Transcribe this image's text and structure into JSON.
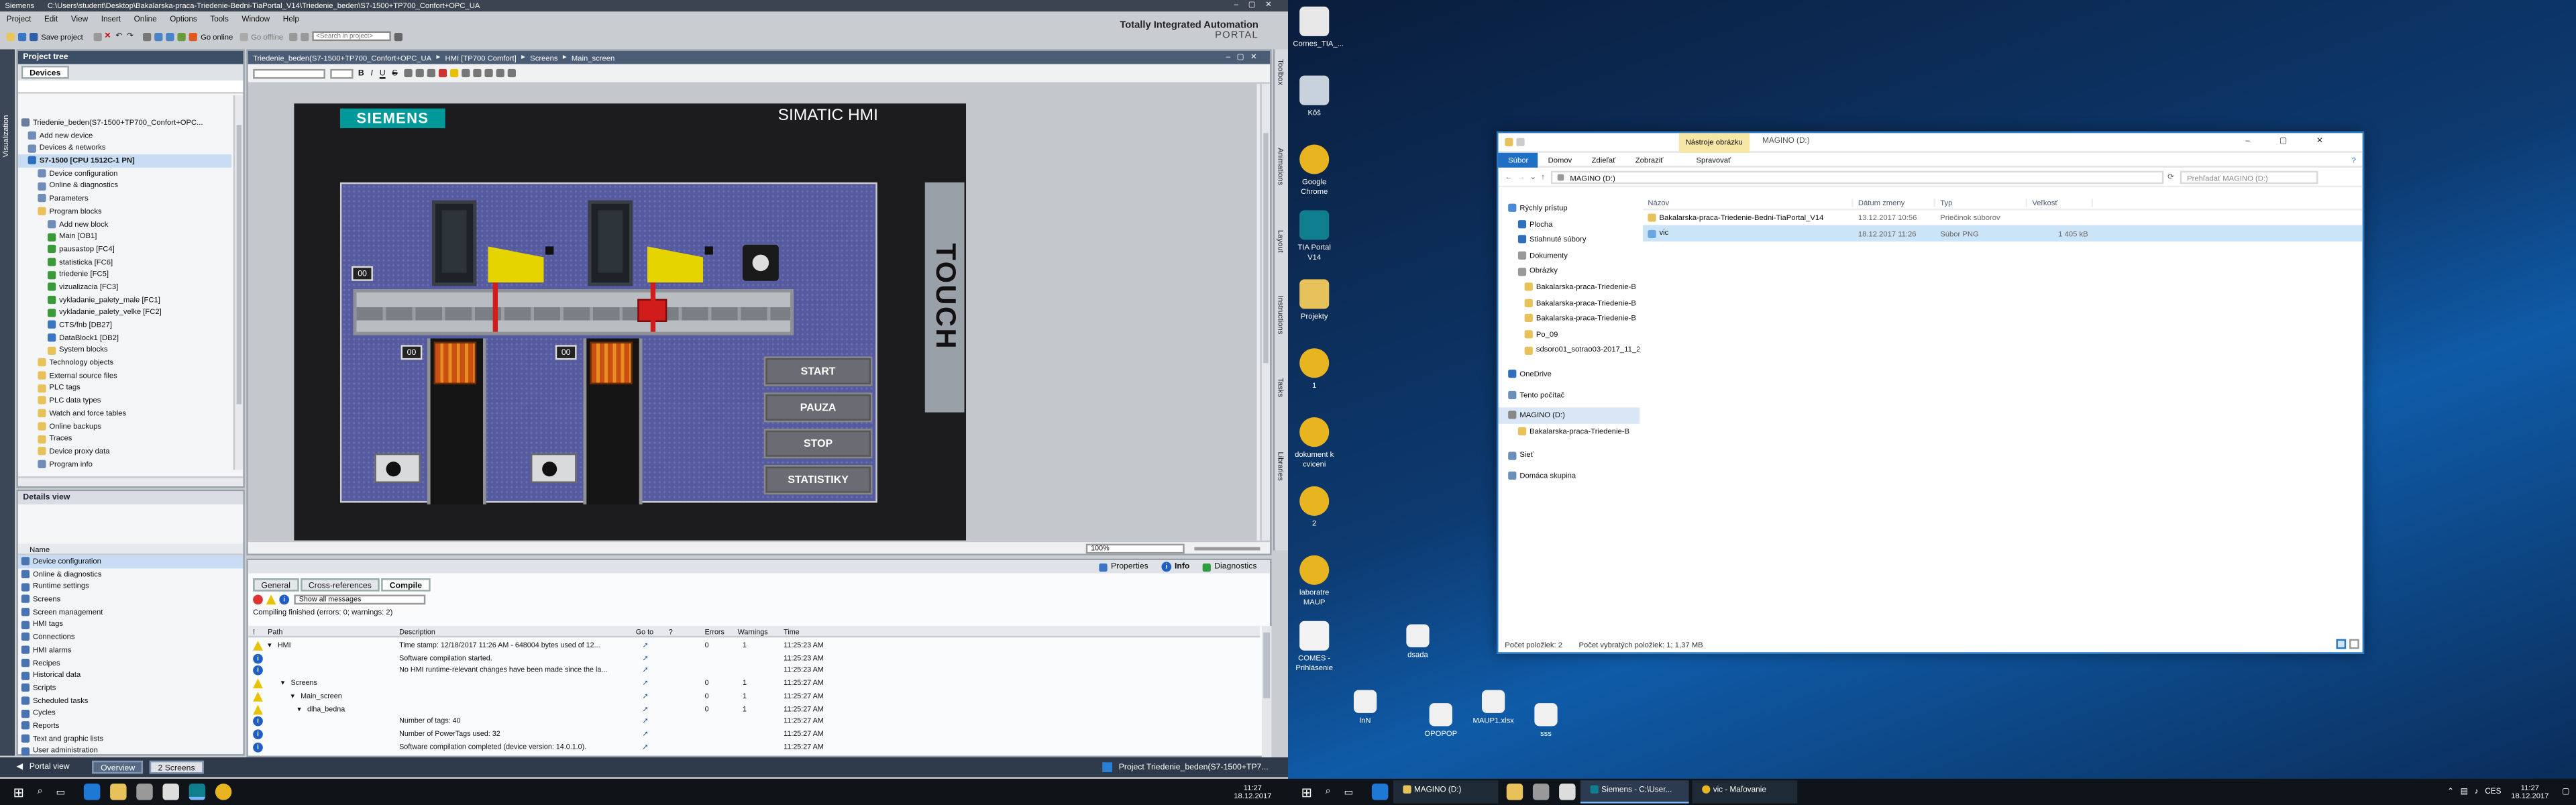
{
  "tia": {
    "title_app": "Siemens",
    "title_path": "C:\\Users\\student\\Desktop\\Bakalarska-praca-Triedenie-Bedni-TiaPortal_V14\\Triedenie_beden\\S7-1500+TP700_Confort+OPC_UA",
    "menu": [
      "Project",
      "Edit",
      "View",
      "Insert",
      "Online",
      "Options",
      "Tools",
      "Window",
      "Help"
    ],
    "toolbar": {
      "save": "Save project",
      "go_online": "Go online",
      "go_offline": "Go offline",
      "search_placeholder": "<Search in project>"
    },
    "brand_line1": "Totally Integrated Automation",
    "brand_line2": "PORTAL",
    "project_tree": {
      "header": "Project tree",
      "tab": "Devices",
      "side_label": "Visualization",
      "items": [
        "Triedenie_beden(S7-1500+TP700_Confort+OPC...",
        "Add new device",
        "Devices & networks",
        "S7-1500 [CPU 1512C-1 PN]",
        "Device configuration",
        "Online & diagnostics",
        "Parameters",
        "Program blocks",
        "Add new block",
        "Main [OB1]",
        "pausastop [FC4]",
        "statisticka [FC6]",
        "triedenie [FC5]",
        "vizualizacia [FC3]",
        "vykladanie_palety_male [FC1]",
        "vykladanie_palety_velke [FC2]",
        "CTS/fnb [DB27]",
        "DataBlock1 [DB2]",
        "System blocks",
        "Technology objects",
        "External source files",
        "PLC tags",
        "PLC data types",
        "Watch and force tables",
        "Online backups",
        "Traces",
        "Device proxy data",
        "Program info"
      ]
    },
    "details": {
      "header": "Details view",
      "col_name": "Name",
      "items": [
        "Device configuration",
        "Online & diagnostics",
        "Runtime settings",
        "Screens",
        "Screen management",
        "HMI tags",
        "Connections",
        "HMI alarms",
        "Recipes",
        "Historical data",
        "Scripts",
        "Scheduled tasks",
        "Cycles",
        "Reports",
        "Text and graphic lists",
        "User administration"
      ]
    },
    "breadcrumb": [
      "Triedenie_beden(S7-1500+TP700_Confort+OPC_UA",
      "HMI [TP700 Comfort]",
      "Screens",
      "Main_screen"
    ],
    "hmi": {
      "logo": "SIEMENS",
      "title": "SIMATIC HMI",
      "touch": "TOUCH",
      "counters": [
        "00",
        "00",
        "00"
      ],
      "buttons": [
        "START",
        "PAUZA",
        "STOP",
        "STATISTIKY"
      ]
    },
    "zoom": "100%",
    "right_tabs": [
      "Toolbox",
      "Animations",
      "Layout",
      "Instructions",
      "Tasks",
      "Libraries"
    ],
    "inspector_tabs": {
      "properties": "Properties",
      "info": "Info",
      "diagnostics": "Diagnostics"
    },
    "bottom_tabs": [
      "General",
      "Cross-references",
      "Compile"
    ],
    "filter": "Show all messages",
    "compile_status": "Compiling finished (errors: 0; warnings: 2)",
    "columns": [
      "!",
      "Path",
      "Description",
      "Go to",
      "?",
      "Errors",
      "Warnings",
      "Time"
    ],
    "rows": [
      {
        "icon": "warn",
        "path": "HMI",
        "desc": "Time stamp: 12/18/2017 11:26 AM - 648004 bytes used of 12...",
        "errors": "0",
        "warnings": "1",
        "time": "11:25:23 AM"
      },
      {
        "icon": "info",
        "path": "",
        "desc": "Software compilation started.",
        "errors": "",
        "warnings": "",
        "time": "11:25:23 AM"
      },
      {
        "icon": "info",
        "path": "",
        "desc": "No HMI runtime-relevant changes have been made since the la...",
        "errors": "",
        "warnings": "",
        "time": "11:25:23 AM"
      },
      {
        "icon": "warn",
        "path": "Screens",
        "desc": "",
        "errors": "0",
        "warnings": "1",
        "time": "11:25:27 AM"
      },
      {
        "icon": "warn",
        "path": "Main_screen",
        "desc": "",
        "errors": "0",
        "warnings": "1",
        "time": "11:25:27 AM"
      },
      {
        "icon": "warn",
        "path": "dlha_bedna",
        "desc": "",
        "errors": "0",
        "warnings": "1",
        "time": "11:25:27 AM"
      },
      {
        "icon": "info",
        "path": "",
        "desc": "Number of tags: 40",
        "errors": "",
        "warnings": "",
        "time": "11:25:27 AM"
      },
      {
        "icon": "info",
        "path": "",
        "desc": "Number of PowerTags used: 32",
        "errors": "",
        "warnings": "",
        "time": "11:25:27 AM"
      },
      {
        "icon": "info",
        "path": "",
        "desc": "Software compilation completed (device version: 14.0.1.0).",
        "errors": "",
        "warnings": "",
        "time": "11:25:27 AM"
      }
    ],
    "portal_view": "Portal view",
    "overview": "Overview",
    "screens_tab": "2 Screens",
    "status_project": "Project Triedenie_beden(S7-1500+TP7..."
  },
  "taskbar_left": {
    "time": "11:27",
    "date": "18.12.2017"
  },
  "desktop_icons": [
    {
      "label": "Cornes_TIA_..."
    },
    {
      "label": "Kôš"
    },
    {
      "label": "Google Chrome"
    },
    {
      "label": "TIA Portal V14"
    },
    {
      "label": "Projekty"
    },
    {
      "label": "1"
    },
    {
      "label": "dokument k cviceni"
    },
    {
      "label": "2"
    },
    {
      "label": "laboratre MAUP"
    },
    {
      "label": "COMES - Prihlásenie"
    }
  ],
  "desktop_files": [
    {
      "label": "dsada"
    },
    {
      "label": "lnN"
    },
    {
      "label": "OPOPOP"
    },
    {
      "label": "MAUP1.xlsx"
    },
    {
      "label": "sss"
    }
  ],
  "explorer": {
    "title": "MAGINO (D:)",
    "context_tab": "Nástroje obrázku",
    "ribbon": [
      "Súbor",
      "Domov",
      "Zdieľať",
      "Zobraziť",
      "Spravovať"
    ],
    "address": "MAGINO (D:)",
    "search_placeholder": "Prehľadať MAGINO (D:)",
    "nav": [
      "Rýchly prístup",
      "Plocha",
      "Stiahnuté súbory",
      "Dokumenty",
      "Obrázky",
      "Bakalarska-praca-Triedenie-B",
      "Bakalarska-praca-Triedenie-B",
      "Bakalarska-praca-Triedenie-B",
      "Po_09",
      "sdsoro01_sotrao03-2017_11_22",
      "OneDrive",
      "Tento počítač",
      "MAGINO (D:)",
      "Bakalarska-praca-Triedenie-B",
      "Sieť",
      "Domáca skupina"
    ],
    "cols": [
      "Názov",
      "Dátum zmeny",
      "Typ",
      "Veľkosť"
    ],
    "files": [
      {
        "name": "Bakalarska-praca-Triedenie-Bedni-TiaPortal_V14",
        "date": "13.12.2017 10:56",
        "type": "Priečinok súborov",
        "size": ""
      },
      {
        "name": "vic",
        "date": "18.12.2017 11:26",
        "type": "Súbor PNG",
        "size": "1 405 kB"
      }
    ],
    "status": [
      "Počet položiek: 2",
      "Počet vybratých položiek: 1; 1,37 MB"
    ]
  },
  "taskbar_right": {
    "items": [
      "MAGINO (D:)",
      "Siemens - C:\\User...",
      "vic - Maľovanie"
    ],
    "lang": "CES",
    "time": "11:27",
    "date": "18.12.2017"
  }
}
